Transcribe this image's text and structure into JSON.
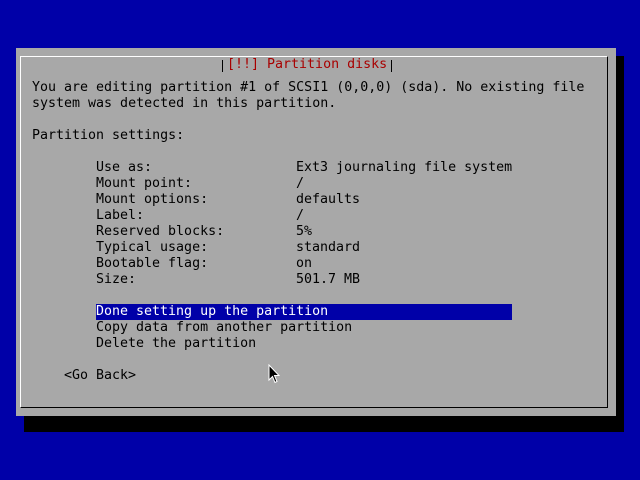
{
  "colors": {
    "screen_background": "#0000a8",
    "dialog_background": "#a8a8a8",
    "title_color": "#a80000",
    "highlight_background": "#0000a8",
    "highlight_text": "#ffffff"
  },
  "dialog": {
    "title": "[!!] Partition disks",
    "intro_line1": "You are editing partition #1 of SCSI1 (0,0,0) (sda). No existing file",
    "intro_line2": "system was detected in this partition.",
    "settings_heading": "Partition settings:",
    "settings": [
      {
        "label": "Use as:",
        "value": "Ext3 journaling file system"
      },
      {
        "label": "Mount point:",
        "value": "/"
      },
      {
        "label": "Mount options:",
        "value": "defaults"
      },
      {
        "label": "Label:",
        "value": "/"
      },
      {
        "label": "Reserved blocks:",
        "value": "5%"
      },
      {
        "label": "Typical usage:",
        "value": "standard"
      },
      {
        "label": "Bootable flag:",
        "value": "on"
      },
      {
        "label": "Size:",
        "value": "501.7 MB"
      }
    ],
    "actions": [
      {
        "label": "Done setting up the partition",
        "selected": true
      },
      {
        "label": "Copy data from another partition",
        "selected": false
      },
      {
        "label": "Delete the partition",
        "selected": false
      }
    ],
    "go_back_label": "<Go Back>"
  },
  "pointer": {
    "icon": "mouse-pointer-icon"
  }
}
